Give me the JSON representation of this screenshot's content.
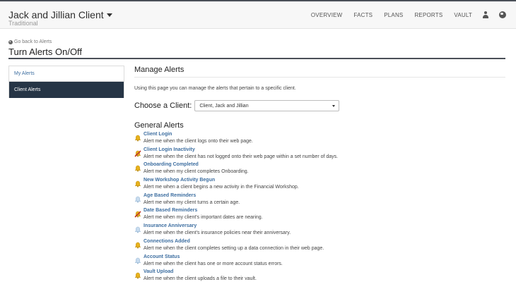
{
  "header": {
    "client_name": "Jack and Jillian Client",
    "client_type": "Traditional",
    "nav": [
      "OVERVIEW",
      "FACTS",
      "PLANS",
      "REPORTS",
      "VAULT"
    ]
  },
  "page": {
    "back_link": "Go back to Alerts",
    "title": "Turn Alerts On/Off"
  },
  "sidebar": {
    "items": [
      {
        "label": "My Alerts"
      },
      {
        "label": "Client Alerts"
      }
    ]
  },
  "main": {
    "title": "Manage Alerts",
    "intro": "Using this page you can manage the alerts that pertain to a specific client.",
    "choose_label": "Choose a Client:",
    "client_select": "Client, Jack and Jillian",
    "general_title": "General Alerts"
  },
  "colors": {
    "bell_on": "#e8b21c",
    "bell_off": "#c8dcef",
    "bell_disabled": "#c0392b",
    "link": "#3d6ea0",
    "sidebar_active": "#263546"
  },
  "alerts": [
    {
      "name": "Client Login",
      "desc": "Alert me when the client logs onto their web page.",
      "icon": "bell-on"
    },
    {
      "name": "Client Login Inactivity",
      "desc": "Alert me when the client has not logged onto their web page within a set number of days.",
      "icon": "bell-disabled"
    },
    {
      "name": "Onboarding Completed",
      "desc": "Alert me when my client completes Onboarding.",
      "icon": "bell-on"
    },
    {
      "name": "New Workshop Activity Begun",
      "desc": "Alert me when a client begins a new activity in the Financial Workshop.",
      "icon": "bell-on"
    },
    {
      "name": "Age Based Reminders",
      "desc": "Alert me when my client turns a certain age.",
      "icon": "bell-off"
    },
    {
      "name": "Date Based Reminders",
      "desc": "Alert me when my client's important dates are nearing.",
      "icon": "bell-disabled"
    },
    {
      "name": "Insurance Anniversary",
      "desc": "Alert me when the client's insurance policies near their anniversary.",
      "icon": "bell-off"
    },
    {
      "name": "Connections Added",
      "desc": "Alert me when the client completes setting up a data connection in their web page.",
      "icon": "bell-on"
    },
    {
      "name": "Account Status",
      "desc": "Alert me when the client has one or more account status errors.",
      "icon": "bell-off"
    },
    {
      "name": "Vault Upload",
      "desc": "Alert me when the client uploads a file to their vault.",
      "icon": "bell-on"
    }
  ]
}
